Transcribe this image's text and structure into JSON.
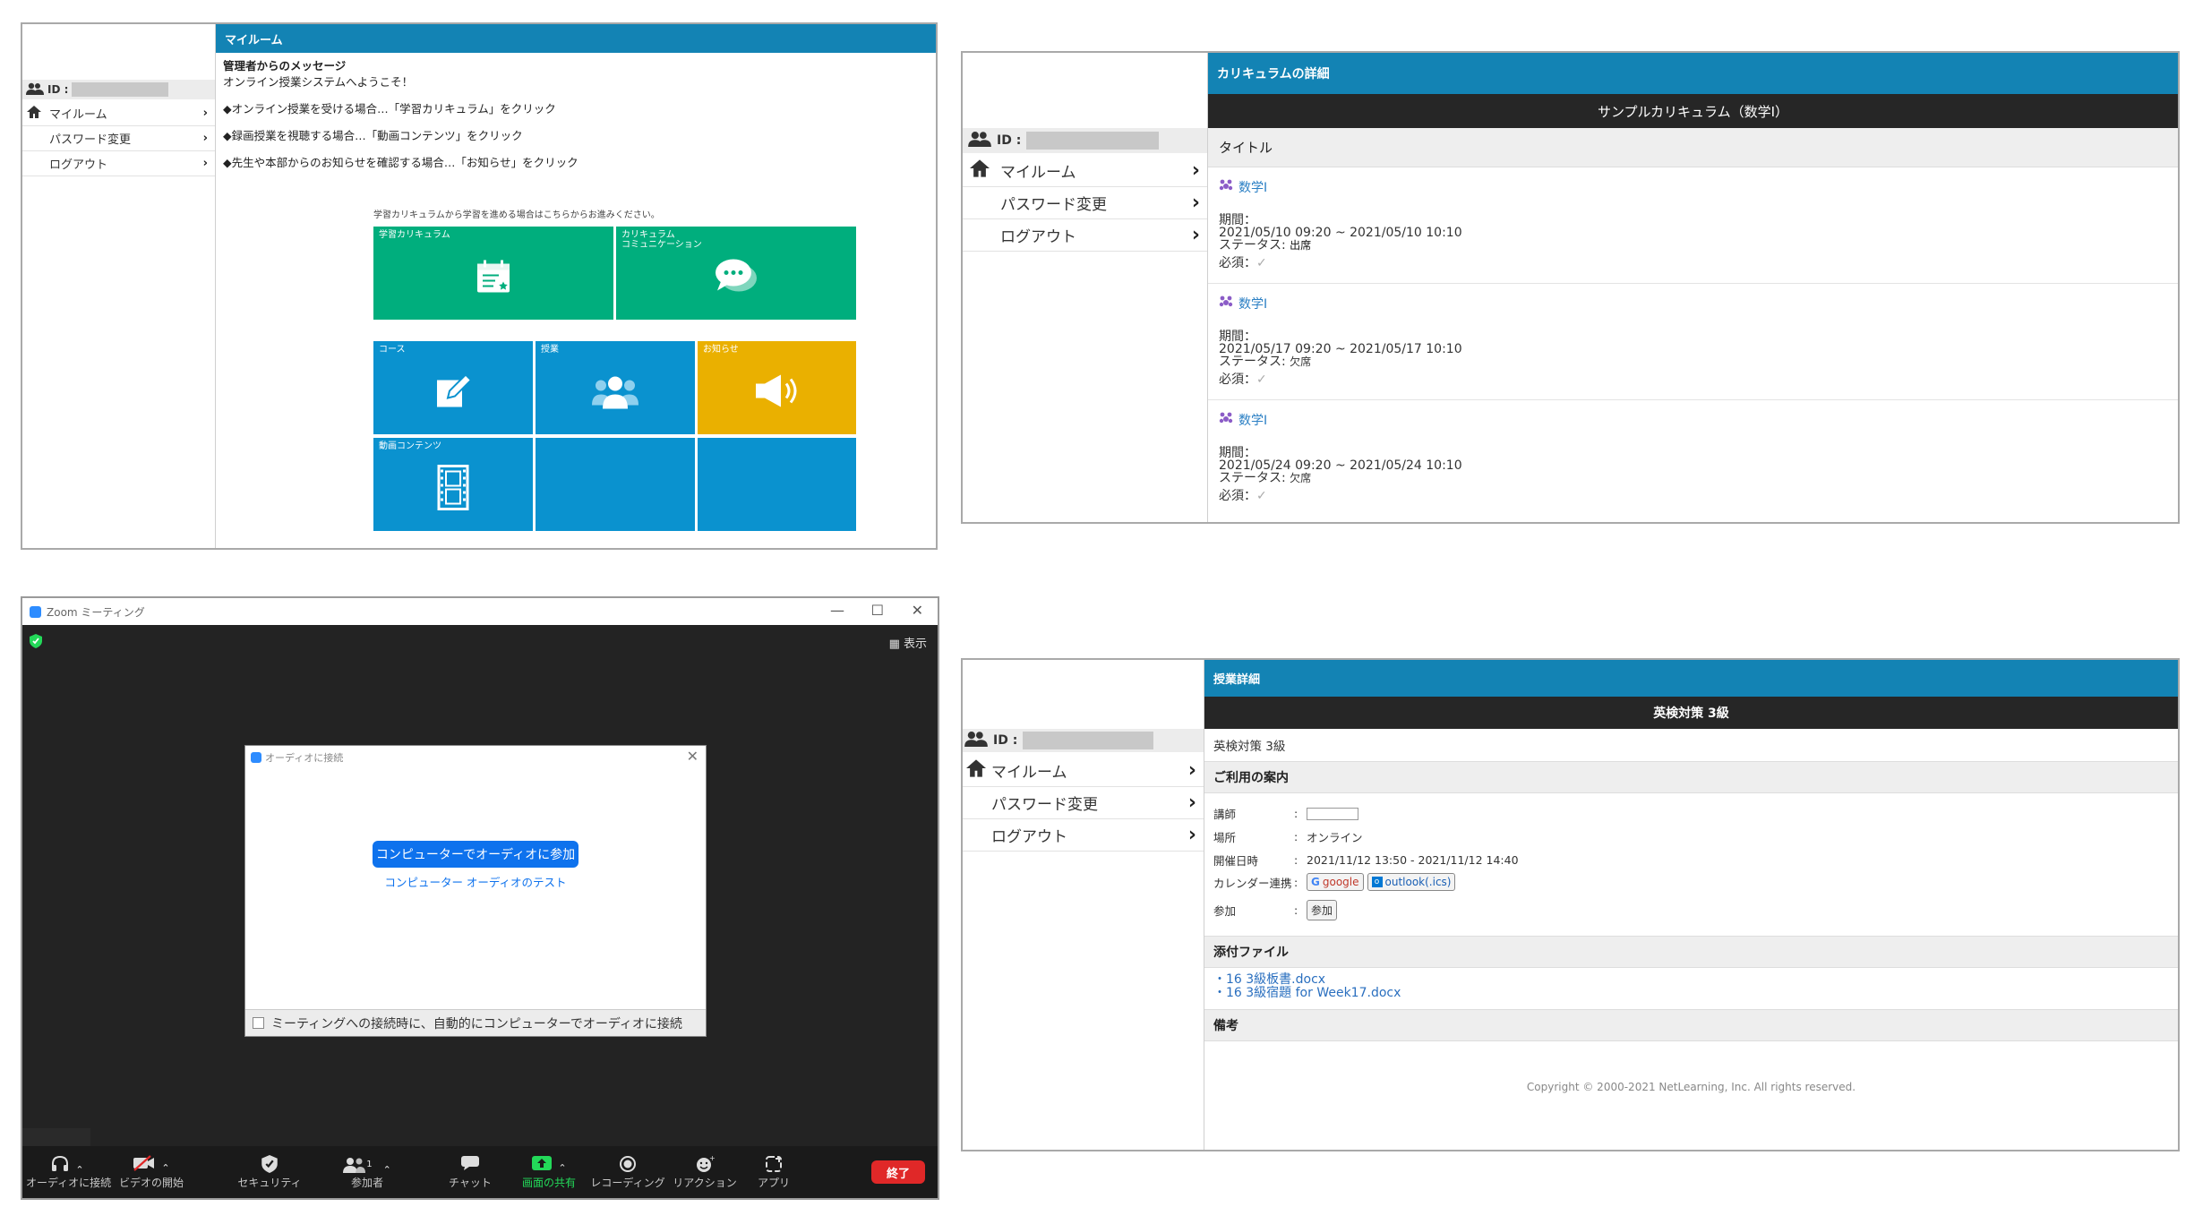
{
  "lms": {
    "id_label": "ID :",
    "nav": [
      {
        "label": "マイルーム"
      },
      {
        "label": "パスワード変更"
      },
      {
        "label": "ログアウト"
      }
    ]
  },
  "myroom": {
    "header": "マイルーム",
    "message_title": "管理者からのメッセージ",
    "lines": [
      "オンライン授業システムへようこそ！",
      "",
      "◆オンライン授業を受ける場合…「学習カリキュラム」をクリック",
      "",
      "◆録画授業を視聴する場合…「動画コンテンツ」をクリック",
      "",
      "◆先生や本部からのお知らせを確認する場合…「お知らせ」をクリック"
    ],
    "tiles_caption": "学習カリキュラムから学習を進める場合はこちらからお進みください。",
    "tiles": [
      {
        "label": "学習カリキュラム",
        "icon": "calendar-icon",
        "color": "#00ae7d"
      },
      {
        "label": "カリキュラム\nコミュニケーション",
        "icon": "chat-bubbles-icon",
        "color": "#00ae7d"
      },
      {
        "label": "コース",
        "icon": "edit-pencil-icon",
        "color": "#0a92cf"
      },
      {
        "label": "授業",
        "icon": "people-icon",
        "color": "#0a92cf"
      },
      {
        "label": "お知らせ",
        "icon": "megaphone-icon",
        "color": "#eab000"
      },
      {
        "label": "動画コンテンツ",
        "icon": "film-icon",
        "color": "#0a92cf"
      },
      {
        "label": "",
        "icon": "",
        "color": "#0a92cf"
      },
      {
        "label": "",
        "icon": "",
        "color": "#0a92cf"
      }
    ]
  },
  "curriculum": {
    "header": "カリキュラムの詳細",
    "title_bar": "サンプルカリキュラム（数学Ⅰ）",
    "subheader": "タイトル",
    "entries": [
      {
        "name": "数学Ⅰ",
        "period_label": "期間：",
        "period": "2021/05/10 09:20 ~ 2021/05/10 10:10",
        "status_label": "ステータス:",
        "status": "出席",
        "required_label": "必須：",
        "check": "✓"
      },
      {
        "name": "数学Ⅰ",
        "period_label": "期間：",
        "period": "2021/05/17 09:20 ~ 2021/05/17 10:10",
        "status_label": "ステータス:",
        "status": "欠席",
        "required_label": "必須：",
        "check": "✓"
      },
      {
        "name": "数学Ⅰ",
        "period_label": "期間：",
        "period": "2021/05/24 09:20 ~ 2021/05/24 10:10",
        "status_label": "ステータス:",
        "status": "欠席",
        "required_label": "必須：",
        "check": "✓"
      }
    ]
  },
  "zoom": {
    "window_title": "Zoom ミーティング",
    "view_label": "表示",
    "dialog_title": "オーディオに接続",
    "join_button": "コンピューターでオーディオに参加",
    "test_link": "コンピューター オーディオのテスト",
    "auto_connect": "ミーティングへの接続時に、自動的にコンピューターでオーディオに接続",
    "toolbar": [
      {
        "label": "オーディオに接続",
        "icon": "headphones-icon"
      },
      {
        "label": "ビデオの開始",
        "icon": "video-off-icon"
      },
      {
        "label": "セキュリティ",
        "icon": "shield-icon"
      },
      {
        "label": "参加者",
        "icon": "participants-icon",
        "count": "1"
      },
      {
        "label": "チャット",
        "icon": "chat-icon"
      },
      {
        "label": "画面の共有",
        "icon": "share-screen-icon"
      },
      {
        "label": "レコーディング",
        "icon": "record-icon"
      },
      {
        "label": "リアクション",
        "icon": "reaction-icon"
      },
      {
        "label": "アプリ",
        "icon": "apps-icon"
      }
    ],
    "end_button": "終了",
    "colors": {
      "share": "#23d959",
      "end": "#e02828",
      "join": "#0e72ed"
    }
  },
  "lesson": {
    "header": "授業詳細",
    "title_bar": "英検対策 3級",
    "course_name": "英検対策 3級",
    "guide_title": "ご利用の案内",
    "fields": {
      "teacher_label": "講師",
      "place_label": "場所",
      "place": "オンライン",
      "datetime_label": "開催日時",
      "datetime": "2021/11/12 13:50 - 2021/11/12 14:40",
      "calendar_label": "カレンダー連携",
      "google": "google",
      "outlook": "outlook(.ics)",
      "join_label": "参加",
      "join_button": "参加"
    },
    "attachments_title": "添付ファイル",
    "files": [
      "・16 3級板書.docx",
      "・16 3級宿題 for Week17.docx"
    ],
    "notes_title": "備考",
    "copyright": "Copyright © 2000-2021 NetLearning, Inc. All rights reserved."
  }
}
